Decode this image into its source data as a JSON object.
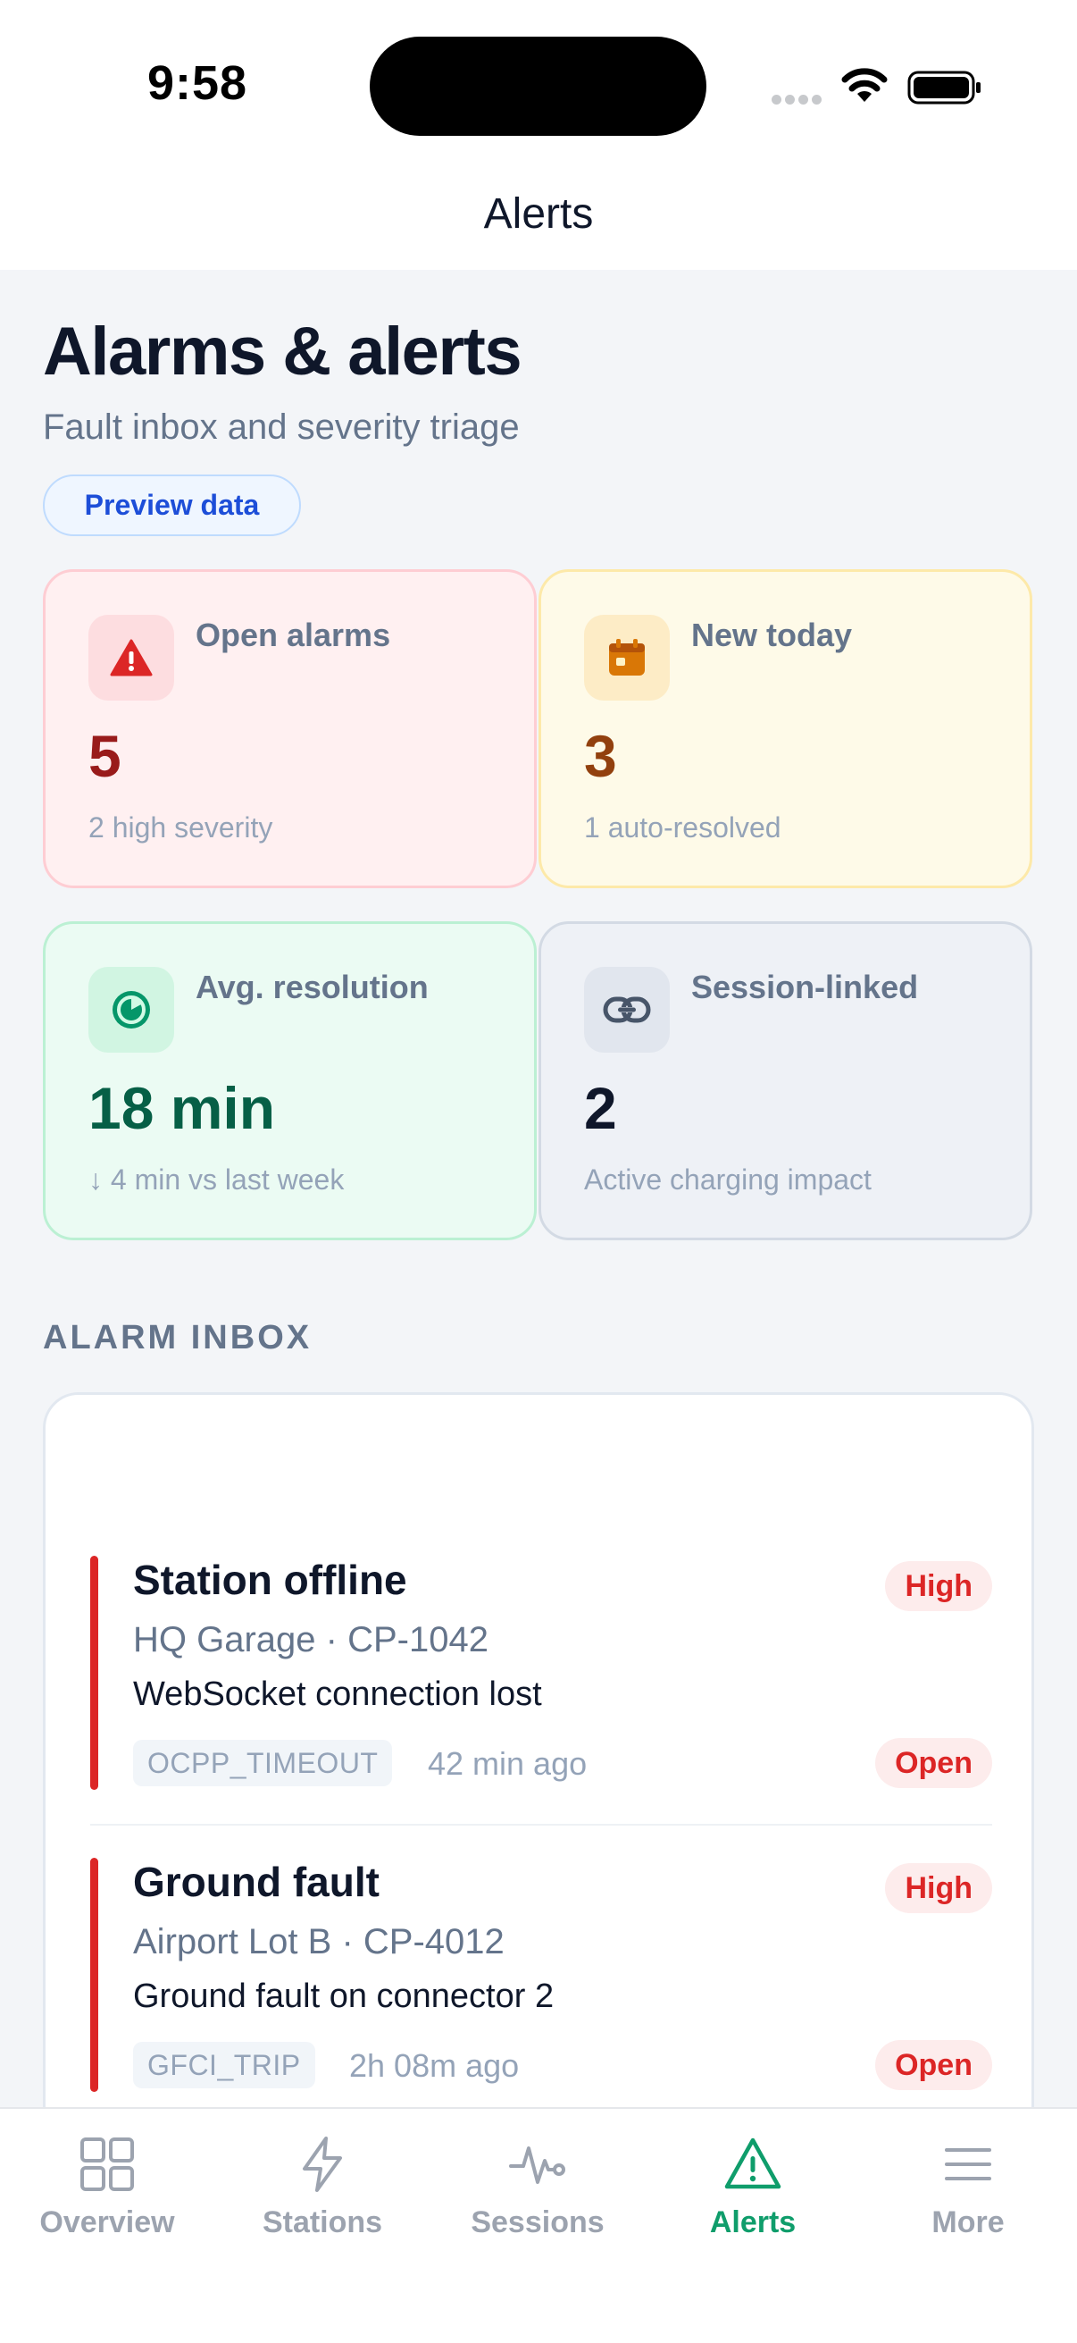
{
  "status_bar": {
    "time": "9:58"
  },
  "nav": {
    "title": "Alerts"
  },
  "header": {
    "title": "Alarms & alerts",
    "subtitle": "Fault inbox and severity triage",
    "badge": "Preview data"
  },
  "stats": [
    {
      "label": "Open alarms",
      "value": "5",
      "note": "2 high severity",
      "icon": "warning-icon"
    },
    {
      "label": "New today",
      "value": "3",
      "note": "1 auto-resolved",
      "icon": "calendar-icon"
    },
    {
      "label": "Avg. resolution",
      "value": "18 min",
      "note": "↓ 4 min vs last week",
      "icon": "timer-icon"
    },
    {
      "label": "Session-linked",
      "value": "2",
      "note": "Active charging impact",
      "icon": "link-icon"
    }
  ],
  "inbox": {
    "section_title": "ALARM INBOX",
    "alarms": [
      {
        "title": "Station offline",
        "location": "HQ Garage · CP-1042",
        "description": "WebSocket connection lost",
        "code": "OCPP_TIMEOUT",
        "time": "42 min ago",
        "severity": "High",
        "status": "Open"
      },
      {
        "title": "Ground fault",
        "location": "Airport Lot B · CP-4012",
        "description": "Ground fault on connector 2",
        "code": "GFCI_TRIP",
        "time": "2h 08m ago",
        "severity": "High",
        "status": "Open"
      }
    ]
  },
  "tabbar": {
    "items": [
      {
        "label": "Overview",
        "icon": "grid-icon"
      },
      {
        "label": "Stations",
        "icon": "bolt-icon"
      },
      {
        "label": "Sessions",
        "icon": "pulse-icon"
      },
      {
        "label": "Alerts",
        "icon": "alert-triangle-icon",
        "active": true
      },
      {
        "label": "More",
        "icon": "menu-icon"
      }
    ]
  },
  "colors": {
    "accent": "#0f9d6b",
    "danger": "#dc2626",
    "badge_blue": "#1d4ed8"
  }
}
